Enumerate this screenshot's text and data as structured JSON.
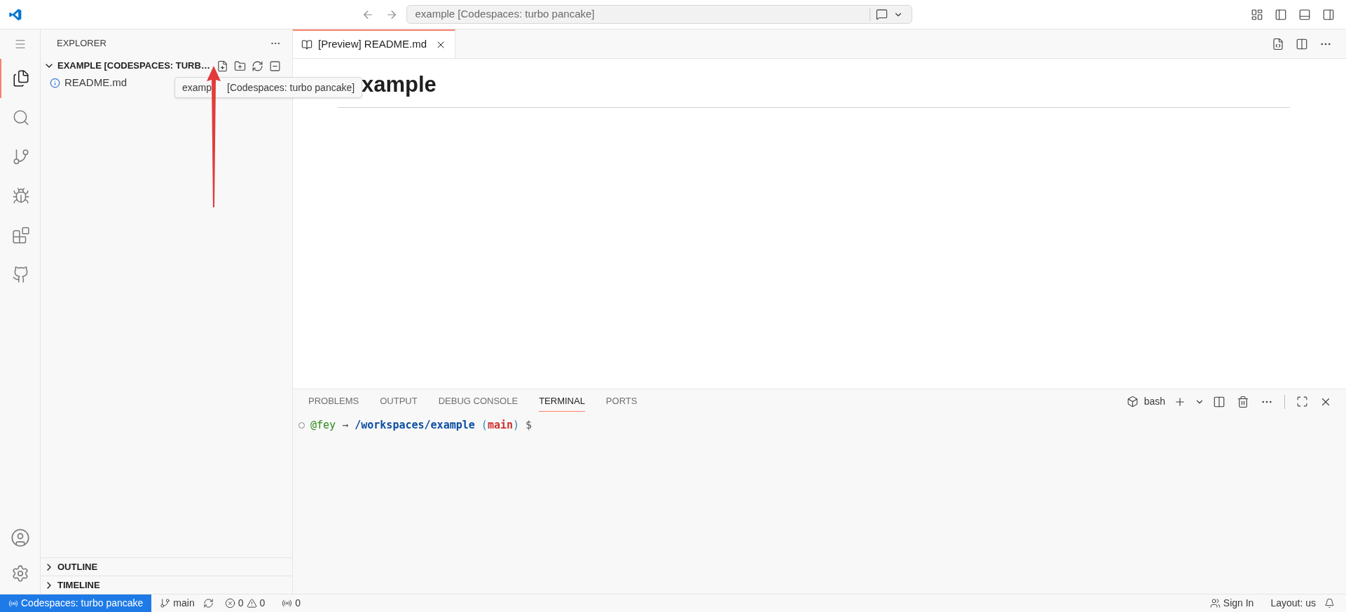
{
  "title_bar": {
    "command_center": "example [Codespaces: turbo pancake]"
  },
  "activity_bar": {
    "items": [
      {
        "kind": "explorer",
        "selected": true
      },
      {
        "kind": "search",
        "selected": false
      },
      {
        "kind": "source-control",
        "selected": false
      },
      {
        "kind": "run-debug",
        "selected": false
      },
      {
        "kind": "extensions",
        "selected": false
      },
      {
        "kind": "github",
        "selected": false
      }
    ]
  },
  "explorer": {
    "title": "EXPLORER",
    "folder": {
      "label": "EXAMPLE [CODESPACES: TURB…",
      "expanded": true,
      "files": [
        {
          "name": "README.md"
        }
      ]
    },
    "tooltip": {
      "before_arrow": "examp",
      "after_arrow": "[Codespaces: turbo pancake]"
    },
    "sections": [
      {
        "label": "OUTLINE",
        "expanded": false
      },
      {
        "label": "TIMELINE",
        "expanded": false
      }
    ]
  },
  "editor": {
    "tabs": [
      {
        "label": "[Preview] README.md",
        "selected": true
      }
    ],
    "heading": "xample"
  },
  "panel": {
    "tabs": [
      {
        "label": "PROBLEMS",
        "selected": false
      },
      {
        "label": "OUTPUT",
        "selected": false
      },
      {
        "label": "DEBUG CONSOLE",
        "selected": false
      },
      {
        "label": "TERMINAL",
        "selected": true
      },
      {
        "label": "PORTS",
        "selected": false
      }
    ],
    "terminal_name": "bash",
    "prompt": {
      "user": "@fey",
      "arrow": "→",
      "path": "/workspaces/example",
      "open": "(",
      "branch": "main",
      "close": ")",
      "symbol": "$"
    }
  },
  "status_bar": {
    "remote": "Codespaces: turbo pancake",
    "branch": "main",
    "errors": "0",
    "warnings": "0",
    "ports": "0",
    "sign_in": "Sign In",
    "layout": "Layout: us"
  }
}
